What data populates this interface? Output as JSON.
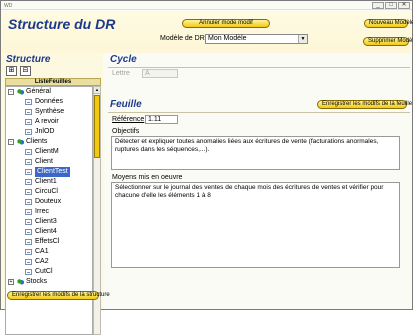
{
  "window": {
    "icon": "WD",
    "minimize_glyph": "_",
    "maximize_glyph": "□",
    "close_glyph": "✕"
  },
  "header": {
    "title": "Structure du DR",
    "cancel_model_button": "Annuler mode modif",
    "new_model_button": "Nouveau Modèle",
    "delete_model_button": "Supprimer Modèle",
    "model_label": "Modèle de DR",
    "model_value": "Mon Modèle",
    "dropdown_glyph": "▼"
  },
  "structure": {
    "title": "Structure",
    "expand_glyph": "⊞",
    "collapse_glyph": "⊟",
    "list_header": "ListeFeuilles",
    "scroll_up_glyph": "▲",
    "expander_minus": "-",
    "expander_plus": "+",
    "items": [
      {
        "label": "Général",
        "type": "group",
        "expanded": true
      },
      {
        "label": "Données",
        "type": "sheet"
      },
      {
        "label": "Synthèse",
        "type": "sheet"
      },
      {
        "label": "A revoir",
        "type": "sheet"
      },
      {
        "label": "JnlOD",
        "type": "sheet"
      },
      {
        "label": "Clients",
        "type": "group",
        "expanded": true
      },
      {
        "label": "ClientM",
        "type": "sheet"
      },
      {
        "label": "Client",
        "type": "sheet"
      },
      {
        "label": "ClientTest",
        "type": "sheet",
        "selected": true
      },
      {
        "label": "Client1",
        "type": "sheet"
      },
      {
        "label": "CircuCl",
        "type": "sheet"
      },
      {
        "label": "Douteux",
        "type": "sheet"
      },
      {
        "label": "Irrec",
        "type": "sheet"
      },
      {
        "label": "Client3",
        "type": "sheet"
      },
      {
        "label": "Client4",
        "type": "sheet"
      },
      {
        "label": "EffetsCl",
        "type": "sheet"
      },
      {
        "label": "CA1",
        "type": "sheet"
      },
      {
        "label": "CA2",
        "type": "sheet"
      },
      {
        "label": "CutCl",
        "type": "sheet"
      },
      {
        "label": "Stocks",
        "type": "group",
        "expanded": false
      }
    ],
    "save_button": "Enregistrer les modifs de la structure"
  },
  "cycle": {
    "title": "Cycle",
    "letter_label": "Lettre",
    "letter_value": "A"
  },
  "sheet": {
    "title": "Feuille",
    "save_button": "Enregistrer les modifs de la feuille",
    "reference_label": "Référence",
    "reference_value": "1.11",
    "objectives_label": "Objectifs",
    "objectives_value": "Détecter et expliquer toutes anomalies liées aux écritures de vente (facturations anormales, ruptures dans les séquences,...).",
    "means_label": "Moyens mis en oeuvre",
    "means_value": "Sélectionner sur le journal des ventes de chaque mois des écritures de ventes et vérifier pour chacune d'elle les éléments 1 à 8"
  },
  "colors": {
    "accent_title": "#1c3a8c",
    "button_yellow": "#f2c811",
    "selection": "#3b67c8"
  }
}
